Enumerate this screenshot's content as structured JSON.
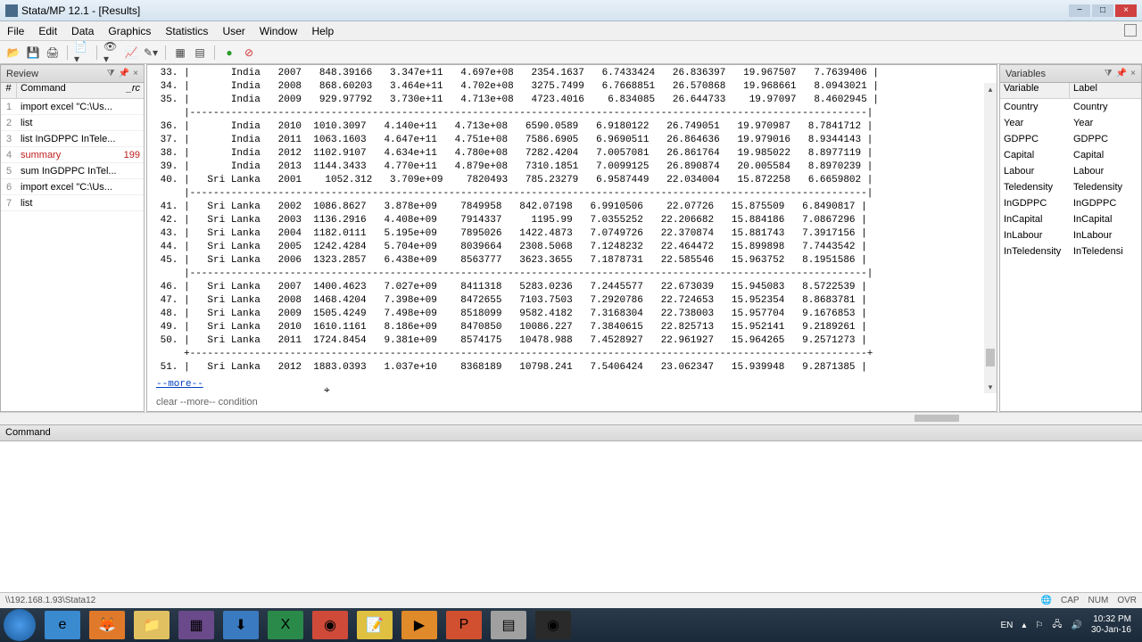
{
  "title": "Stata/MP 12.1 - [Results]",
  "menu": [
    "File",
    "Edit",
    "Data",
    "Graphics",
    "Statistics",
    "User",
    "Window",
    "Help"
  ],
  "review": {
    "title": "Review",
    "col_num": "#",
    "col_cmd": "Command",
    "col_rc": "_rc",
    "items": [
      {
        "n": "1",
        "cmd": "import excel \"C:\\Us...",
        "rc": "",
        "err": false
      },
      {
        "n": "2",
        "cmd": "list",
        "rc": "",
        "err": false
      },
      {
        "n": "3",
        "cmd": "list InGDPPC InTele...",
        "rc": "",
        "err": false
      },
      {
        "n": "4",
        "cmd": "summary",
        "rc": "199",
        "err": true
      },
      {
        "n": "5",
        "cmd": "sum InGDPPC InTel...",
        "rc": "",
        "err": false
      },
      {
        "n": "6",
        "cmd": "import excel \"C:\\Us...",
        "rc": "",
        "err": false
      },
      {
        "n": "7",
        "cmd": "list",
        "rc": "",
        "err": false
      }
    ]
  },
  "variables": {
    "title": "Variables",
    "col_var": "Variable",
    "col_lab": "Label",
    "items": [
      {
        "v": "Country",
        "l": "Country"
      },
      {
        "v": "Year",
        "l": "Year"
      },
      {
        "v": "GDPPC",
        "l": "GDPPC"
      },
      {
        "v": "Capital",
        "l": "Capital"
      },
      {
        "v": "Labour",
        "l": "Labour"
      },
      {
        "v": "Teledensity",
        "l": "Teledensity"
      },
      {
        "v": "InGDPPC",
        "l": "InGDPPC"
      },
      {
        "v": "InCapital",
        "l": "InCapital"
      },
      {
        "v": "InLabour",
        "l": "InLabour"
      },
      {
        "v": "InTeledensity",
        "l": "InTeledensi"
      }
    ]
  },
  "results": {
    "rows": [
      " 33. |       India   2007   848.39166   3.347e+11   4.697e+08   2354.1637   6.7433424   26.836397   19.967507   7.7639406 |",
      " 34. |       India   2008   868.60203   3.464e+11   4.702e+08   3275.7499   6.7668851   26.570868   19.968661   8.0943021 |",
      " 35. |       India   2009   929.97792   3.730e+11   4.713e+08   4723.4016    6.834085   26.644733    19.97097   8.4602945 |",
      "     |-------------------------------------------------------------------------------------------------------------------|",
      " 36. |       India   2010  1010.3097   4.140e+11   4.713e+08   6590.0589   6.9180122   26.749051   19.970987   8.7841712 |",
      " 37. |       India   2011  1063.1603   4.647e+11   4.751e+08   7586.6905   6.9690511   26.864636   19.979016   8.9344143 |",
      " 38. |       India   2012  1102.9107   4.634e+11   4.780e+08   7282.4204   7.0057081   26.861764   19.985022   8.8977119 |",
      " 39. |       India   2013  1144.3433   4.770e+11   4.879e+08   7310.1851   7.0099125   26.890874   20.005584   8.8970239 |",
      " 40. |   Sri Lanka   2001    1052.312   3.709e+09    7820493   785.23279   6.9587449   22.034004   15.872258   6.6659802 |",
      "     |-------------------------------------------------------------------------------------------------------------------|",
      " 41. |   Sri Lanka   2002  1086.8627   3.878e+09    7849958   842.07198   6.9910506    22.07726   15.875509   6.8490817 |",
      " 42. |   Sri Lanka   2003  1136.2916   4.408e+09    7914337     1195.99   7.0355252   22.206682   15.884186   7.0867296 |",
      " 43. |   Sri Lanka   2004  1182.0111   5.195e+09    7895026   1422.4873   7.0749726   22.370874   15.881743   7.3917156 |",
      " 44. |   Sri Lanka   2005  1242.4284   5.704e+09    8039664   2308.5068   7.1248232   22.464472   15.899898   7.7443542 |",
      " 45. |   Sri Lanka   2006  1323.2857   6.438e+09    8563777   3623.3655   7.1878731   22.585546   15.963752   8.1951586 |",
      "     |-------------------------------------------------------------------------------------------------------------------|",
      " 46. |   Sri Lanka   2007  1400.4623   7.027e+09    8411318   5283.0236   7.2445577   22.673039   15.945083   8.5722539 |",
      " 47. |   Sri Lanka   2008  1468.4204   7.398e+09    8472655   7103.7503   7.2920786   22.724653   15.952354   8.8683781 |",
      " 48. |   Sri Lanka   2009  1505.4249   7.498e+09    8518099   9582.4182   7.3168304   22.738003   15.957704   9.1676853 |",
      " 49. |   Sri Lanka   2010  1610.1161   8.186e+09    8470850   10086.227   7.3840615   22.825713   15.952141   9.2189261 |",
      " 50. |   Sri Lanka   2011  1724.8454   9.381e+09    8574175   10478.988   7.4528927   22.961927   15.964265   9.2571273 |",
      "     +-------------------------------------------------------------------------------------------------------------------+",
      " 51. |   Sri Lanka   2012  1883.0393   1.037e+10    8368189   10798.241   7.5406424   23.062347   15.939948   9.2871385 |"
    ],
    "more": "--more--",
    "status": "clear --more-- condition"
  },
  "command": {
    "title": "Command"
  },
  "statusbar": {
    "path": "\\\\192.168.1.93\\Stata12",
    "caps": "CAP",
    "num": "NUM",
    "ovr": "OVR"
  },
  "tray": {
    "lang": "EN",
    "time": "10:32 PM",
    "date": "30-Jan-16"
  }
}
